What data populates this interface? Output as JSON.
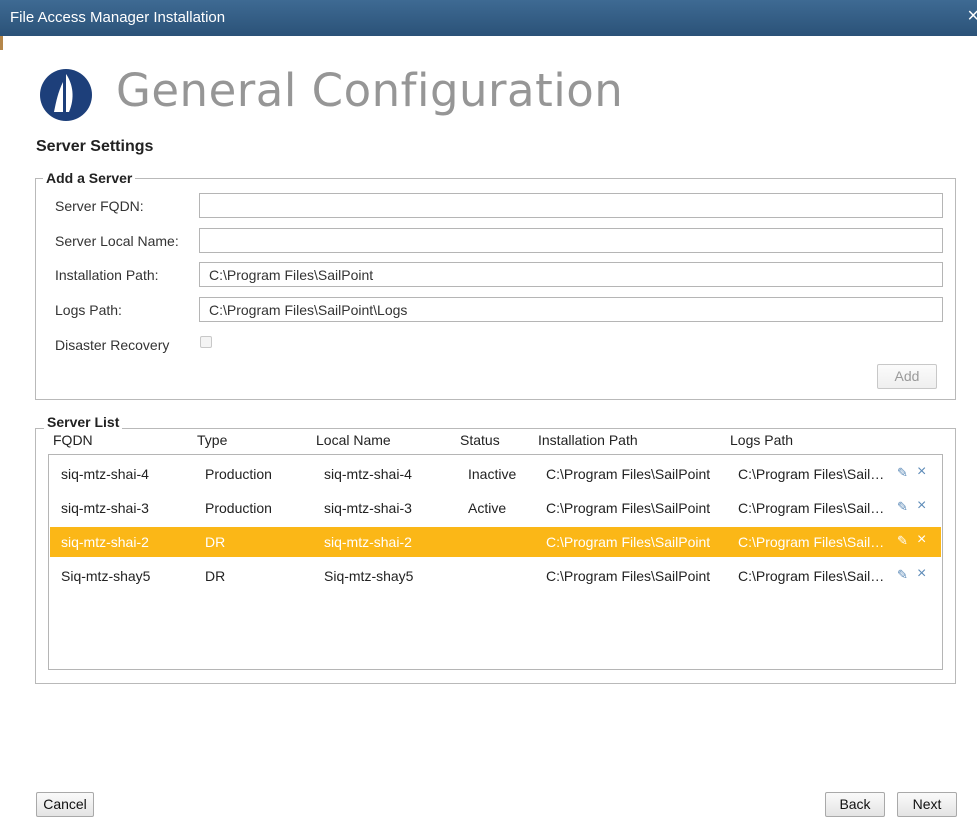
{
  "window": {
    "title": "File Access Manager Installation",
    "close_glyph": "×"
  },
  "header": {
    "title": "General Configuration",
    "brand_color": "#1d3f7a"
  },
  "section": {
    "title": "Server Settings"
  },
  "add_server": {
    "legend": "Add a Server",
    "fields": {
      "fqdn": {
        "label": "Server FQDN:",
        "value": ""
      },
      "local_name": {
        "label": "Server Local Name:",
        "value": ""
      },
      "install_path": {
        "label": "Installation Path:",
        "value": "C:\\Program Files\\SailPoint"
      },
      "logs_path": {
        "label": "Logs Path:",
        "value": "C:\\Program Files\\SailPoint\\Logs"
      }
    },
    "disaster_recovery": {
      "label": "Disaster Recovery",
      "checked": false
    },
    "add_button": "Add"
  },
  "server_list": {
    "legend": "Server List",
    "columns": [
      "FQDN",
      "Type",
      "Local Name",
      "Status",
      "Installation Path",
      "Logs Path"
    ],
    "rows": [
      {
        "fqdn": "siq-mtz-shai-4",
        "type": "Production",
        "local_name": "siq-mtz-shai-4",
        "status": "Inactive",
        "install_path": "C:\\Program Files\\SailPoint",
        "logs_path": "C:\\Program Files\\Sail…"
      },
      {
        "fqdn": "siq-mtz-shai-3",
        "type": "Production",
        "local_name": "siq-mtz-shai-3",
        "status": "Active",
        "install_path": "C:\\Program Files\\SailPoint",
        "logs_path": "C:\\Program Files\\Sail…"
      },
      {
        "fqdn": "siq-mtz-shai-2",
        "type": "DR",
        "local_name": "siq-mtz-shai-2",
        "status": "",
        "install_path": "C:\\Program Files\\SailPoint",
        "logs_path": "C:\\Program Files\\Sail…"
      },
      {
        "fqdn": "Siq-mtz-shay5",
        "type": "DR",
        "local_name": "Siq-mtz-shay5",
        "status": "",
        "install_path": "C:\\Program Files\\SailPoint",
        "logs_path": "C:\\Program Files\\Sail…"
      }
    ],
    "selected_row": "siq-mtz-shai-2",
    "selection_color": "#fbb717",
    "row_actions": {
      "edit_icon": "pencil-icon",
      "edit_glyph": "✎",
      "delete_icon": "close-icon",
      "delete_glyph": "×"
    }
  },
  "footer": {
    "cancel": "Cancel",
    "back": "Back",
    "next": "Next"
  }
}
